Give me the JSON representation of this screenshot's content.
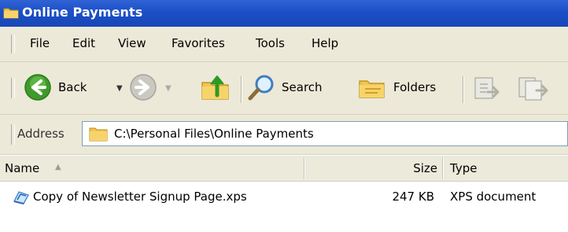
{
  "window": {
    "title": "Online Payments"
  },
  "menu": {
    "items": [
      "File",
      "Edit",
      "View",
      "Favorites",
      "Tools",
      "Help"
    ]
  },
  "toolbar": {
    "back_label": "Back",
    "search_label": "Search",
    "folders_label": "Folders"
  },
  "address": {
    "label": "Address",
    "path": "C:\\Personal Files\\Online Payments"
  },
  "list": {
    "columns": {
      "name": "Name",
      "size": "Size",
      "type": "Type"
    },
    "rows": [
      {
        "name": "Copy of Newsletter Signup Page.xps",
        "size": "247 KB",
        "type": "XPS document"
      }
    ]
  },
  "colors": {
    "title_bar": "#1c4fc6",
    "chrome": "#ece9d8",
    "back_arrow": "#3f9a2b"
  },
  "icons": [
    "folder-icon",
    "back-icon",
    "forward-icon",
    "up-folder-icon",
    "search-icon",
    "folders-icon",
    "move-to-icon",
    "copy-to-icon",
    "xps-document-icon"
  ]
}
